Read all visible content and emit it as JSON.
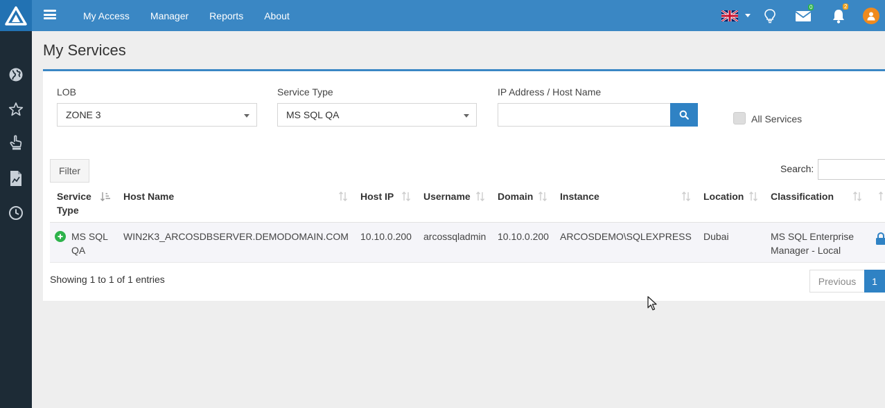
{
  "nav": {
    "items": [
      {
        "label": "My Access"
      },
      {
        "label": "Manager"
      },
      {
        "label": "Reports"
      },
      {
        "label": "About"
      }
    ],
    "mail_count": "0",
    "notification_count": "2"
  },
  "page": {
    "title": "My Services"
  },
  "filters": {
    "lob_label": "LOB",
    "lob_value": "ZONE 3",
    "service_type_label": "Service Type",
    "service_type_value": "MS SQL QA",
    "ip_label": "IP Address / Host Name",
    "ip_value": "",
    "all_services_label": "All Services"
  },
  "table": {
    "filter_button": "Filter",
    "search_label": "Search:",
    "headers": {
      "service_type": "Service Type",
      "host_name": "Host Name",
      "host_ip": "Host IP",
      "username": "Username",
      "domain": "Domain",
      "instance": "Instance",
      "location": "Location",
      "classification": "Classification"
    },
    "rows": [
      {
        "service_type": "MS SQL QA",
        "host_name": "WIN2K3_ARCOSDBSERVER.DEMODOMAIN.COM",
        "host_ip": "10.10.0.200",
        "username": "arcossqladmin",
        "domain": "10.10.0.200",
        "instance": "ARCOSDEMO\\SQLEXPRESS",
        "location": "Dubai",
        "classification": "MS SQL Enterprise Manager - Local"
      }
    ],
    "showing_text": "Showing 1 to 1 of 1 entries",
    "prev_label": "Previous",
    "page_label": "1"
  },
  "colors": {
    "topbar": "#3a87c4",
    "sidebar": "#1d2b36",
    "accent": "#2f82c4",
    "avatar": "#f08a1d",
    "mail_badge": "#2eb34b",
    "bell_badge": "#f0a21d",
    "add_icon": "#2eb34b"
  }
}
